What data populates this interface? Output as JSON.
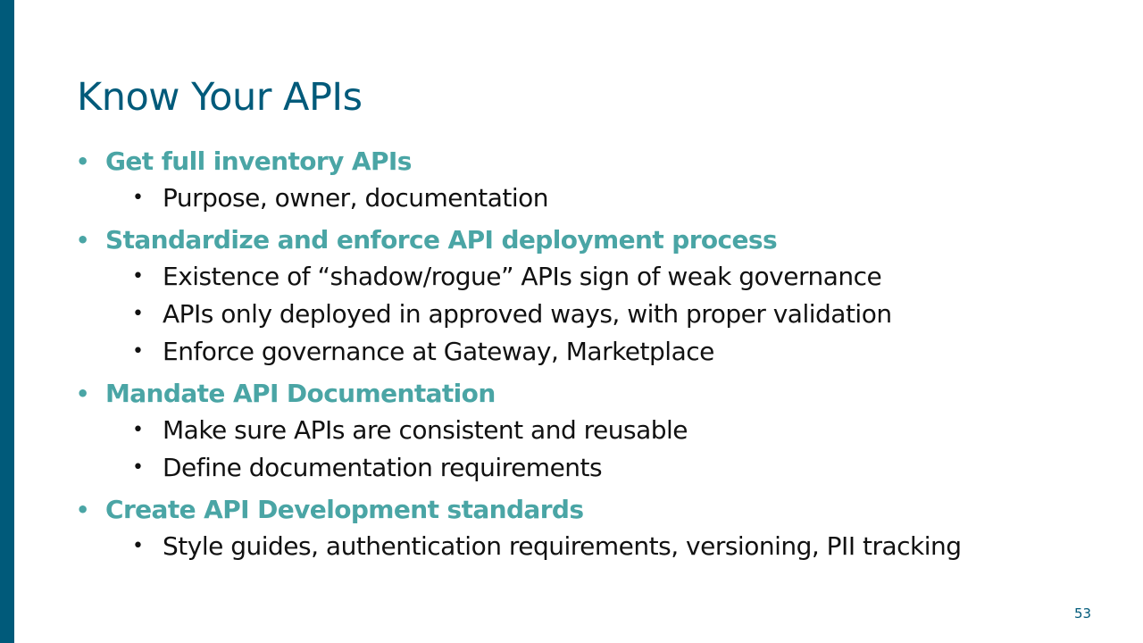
{
  "slide": {
    "title": "Know Your APIs",
    "page_number": "53",
    "colors": {
      "accent_bar": "#005a7a",
      "title": "#005a7a",
      "level1_bullet": "#4aa5a5",
      "level2_text": "#111111"
    },
    "bullet_glyph": "•",
    "bullets": [
      {
        "text": "Get full inventory APIs",
        "sub": [
          "Purpose, owner, documentation"
        ]
      },
      {
        "text": "Standardize and enforce API deployment process",
        "sub": [
          "Existence of “shadow/rogue” APIs sign of weak governance",
          "APIs only deployed in approved ways, with proper validation",
          "Enforce governance at Gateway, Marketplace"
        ]
      },
      {
        "text": "Mandate API Documentation",
        "sub": [
          "Make sure APIs are consistent and reusable",
          "Define documentation requirements"
        ]
      },
      {
        "text": "Create API Development standards",
        "sub": [
          "Style guides, authentication requirements, versioning, PII tracking"
        ]
      }
    ]
  }
}
